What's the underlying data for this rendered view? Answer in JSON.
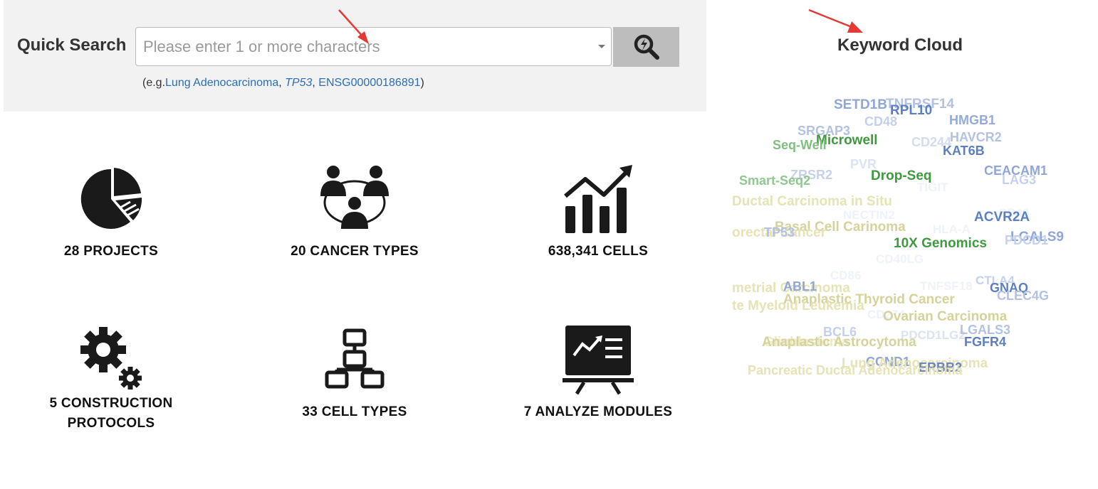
{
  "search": {
    "label": "Quick Search",
    "placeholder": "Please enter 1 or more characters",
    "example_prefix": "(e.g.",
    "example_1": "Lung Adenocarcinoma",
    "example_sep1": ", ",
    "example_2": "TP53",
    "example_sep2": ", ",
    "example_3": "ENSG00000186891",
    "example_suffix": ")"
  },
  "stats": [
    {
      "label": "28 PROJECTS",
      "icon": "pie-chart-icon"
    },
    {
      "label": "20 CANCER TYPES",
      "icon": "people-network-icon"
    },
    {
      "label": "638,341 CELLS",
      "icon": "growth-chart-icon"
    },
    {
      "label_line1": "5 CONSTRUCTION",
      "label_line2": "PROTOCOLS",
      "icon": "gears-icon"
    },
    {
      "label": "33 CELL TYPES",
      "icon": "hierarchy-icon"
    },
    {
      "label": "7 ANALYZE MODULES",
      "icon": "presentation-board-icon"
    }
  ],
  "keyword_cloud": {
    "title": "Keyword Cloud",
    "words": [
      {
        "text": "SETD1B",
        "color": "#8fa6d6"
      },
      {
        "text": "TNFRSF14",
        "color": "#b3c1e3"
      },
      {
        "text": "RPL10",
        "color": "#5c7fc2"
      },
      {
        "text": "CD48",
        "color": "#c5d1ec"
      },
      {
        "text": "HMGB1",
        "color": "#94abd9"
      },
      {
        "text": "SRGAP3",
        "color": "#b3c1e3"
      },
      {
        "text": "Microwell",
        "color": "#3f9a3f"
      },
      {
        "text": "Seq-Well",
        "color": "#7fbf7f"
      },
      {
        "text": "CD244",
        "color": "#d3ddf1"
      },
      {
        "text": "HAVCR2",
        "color": "#b3c1e3"
      },
      {
        "text": "KAT6B",
        "color": "#5c7fc2"
      },
      {
        "text": "PVR",
        "color": "#dbe3f3"
      },
      {
        "text": "CEACAM1",
        "color": "#8fa6d6"
      },
      {
        "text": "ZRSR2",
        "color": "#c5d1ec"
      },
      {
        "text": "Drop-Seq",
        "color": "#3f9a3f"
      },
      {
        "text": "Smart-Seq2",
        "color": "#8fc78f"
      },
      {
        "text": "LAG3",
        "color": "#c5d1ec"
      },
      {
        "text": "TIGIT",
        "color": "#eef2fa"
      },
      {
        "text": "Ductal Carcinoma in Situ",
        "color": "#e6e3b5"
      },
      {
        "text": "NECTIN2",
        "color": "#eef2fa"
      },
      {
        "text": "CD40",
        "color": "#eef2fa"
      },
      {
        "text": "ACVR2A",
        "color": "#5c7fc2"
      },
      {
        "text": "Basal Cell Carinoma",
        "color": "#d6d39a"
      },
      {
        "text": "orectal Cancer",
        "color": "#e6e3b5"
      },
      {
        "text": "TP53",
        "color": "#b3c1e3"
      },
      {
        "text": "HLA-A",
        "color": "#eef2fa"
      },
      {
        "text": "LGALS9",
        "color": "#8fa6d6"
      },
      {
        "text": "PDCD1",
        "color": "#c5d1ec"
      },
      {
        "text": "10X Genomics",
        "color": "#3f9a3f"
      },
      {
        "text": "CD40LG",
        "color": "#eef2fa"
      },
      {
        "text": "CD86",
        "color": "#eef2fa"
      },
      {
        "text": "CTLA4",
        "color": "#c5d1ec"
      },
      {
        "text": "metrial Carcinoma",
        "color": "#e6e3b5"
      },
      {
        "text": "ABL1",
        "color": "#8fa6d6"
      },
      {
        "text": "TNFSF18",
        "color": "#eef2fa"
      },
      {
        "text": "GNAQ",
        "color": "#5c7fc2"
      },
      {
        "text": "CLEC4G",
        "color": "#b3c1e3"
      },
      {
        "text": "Anaplastic Thyroid Cancer",
        "color": "#d6d39a"
      },
      {
        "text": "te Myeloid Leukemia",
        "color": "#e6e3b5"
      },
      {
        "text": "CD274",
        "color": "#eef2fa"
      },
      {
        "text": "Ovarian Carcinoma",
        "color": "#d6d39a"
      },
      {
        "text": "BCL6",
        "color": "#c5d1ec"
      },
      {
        "text": "PDCD1LG2",
        "color": "#dbe3f3"
      },
      {
        "text": "LGALS3",
        "color": "#b3c1e3"
      },
      {
        "text": "Glioblastoma",
        "color": "#eceac6"
      },
      {
        "text": "Anaplastic Astrocytoma",
        "color": "#d6d39a"
      },
      {
        "text": "FGFR4",
        "color": "#5c7fc2"
      },
      {
        "text": "CCND1",
        "color": "#8fa6d6"
      },
      {
        "text": "Lung Adenocarcinoma",
        "color": "#e6e3b5"
      },
      {
        "text": "ERBB2",
        "color": "#6b86bf"
      },
      {
        "text": "Pancreatic Ductal Adenocarcinoma",
        "color": "#e6e3b5"
      }
    ]
  },
  "colors": {
    "panel_bg": "#f2f2f2",
    "search_button_bg": "#bdbdbd",
    "link": "#2a6fb8",
    "arrow": "#e53935"
  }
}
